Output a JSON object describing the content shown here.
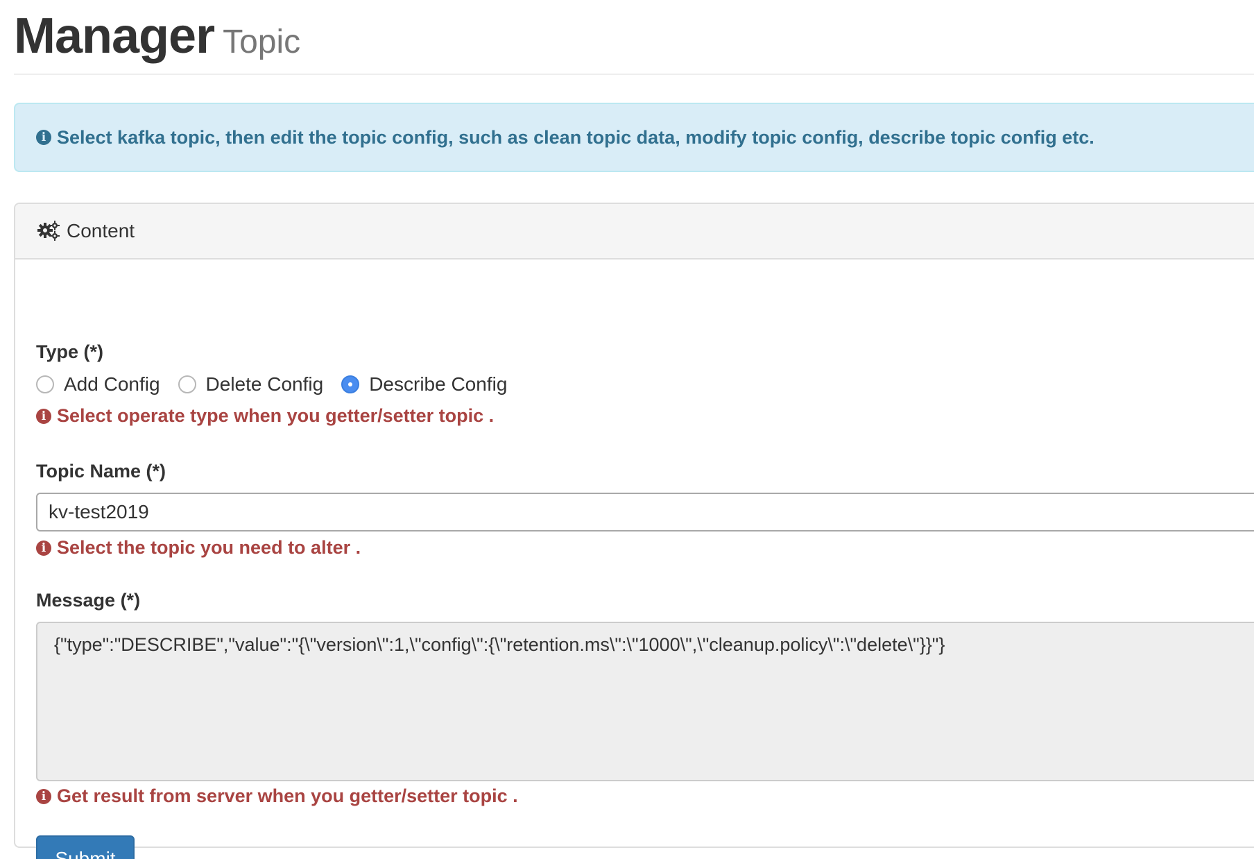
{
  "header": {
    "title": "Manager",
    "subtitle": "Topic"
  },
  "alert": {
    "icon": "info-icon",
    "text": "Select kafka topic, then edit the topic config, such as clean topic data, modify topic config, describe topic config etc."
  },
  "panel": {
    "icon": "gears-icon",
    "title": "Content"
  },
  "form": {
    "type": {
      "label": "Type (*)",
      "options": [
        {
          "label": "Add Config",
          "checked": false
        },
        {
          "label": "Delete Config",
          "checked": false
        },
        {
          "label": "Describe Config",
          "checked": true
        }
      ],
      "help": "Select operate type when you getter/setter topic ."
    },
    "topic": {
      "label": "Topic Name (*)",
      "value": "kv-test2019",
      "help": "Select the topic you need to alter ."
    },
    "message": {
      "label": "Message (*)",
      "value": "{\"type\":\"DESCRIBE\",\"value\":\"{\\\"version\\\":1,\\\"config\\\":{\\\"retention.ms\\\":\\\"1000\\\",\\\"cleanup.policy\\\":\\\"delete\\\"}}\"}",
      "help": "Get result from server when you getter/setter topic ."
    },
    "submit_label": "Submit"
  },
  "colors": {
    "alert_text": "#31708f",
    "alert_bg": "#d9edf7",
    "help_text": "#a94442",
    "primary": "#337ab7",
    "radio_checked": "#4a8df0"
  }
}
